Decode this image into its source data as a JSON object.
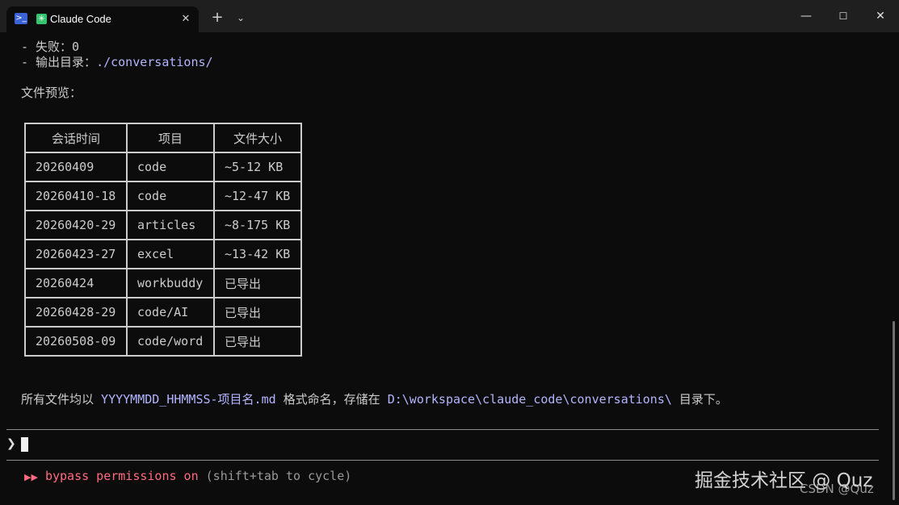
{
  "titlebar": {
    "tab_title": "Claude Code",
    "tab_icon": "powershell-icon",
    "tab_badge_icon": "claude-asterisk-icon",
    "close_icon": "close-icon",
    "new_tab_icon": "plus-icon",
    "dropdown_icon": "chevron-down-icon",
    "window_controls": [
      "minimize-icon",
      "maximize-icon",
      "close-icon"
    ]
  },
  "output": {
    "failed_line": "- 失败：0",
    "output_dir_label": "- 输出目录：",
    "output_dir_path": "./conversations/",
    "preview_heading": "文件预览："
  },
  "table": {
    "headers": [
      "会话时间",
      "项目",
      "文件大小"
    ],
    "rows": [
      [
        "20260409",
        "code",
        "~5-12 KB"
      ],
      [
        "20260410-18",
        "code",
        "~12-47 KB"
      ],
      [
        "20260420-29",
        "articles",
        "~8-175 KB"
      ],
      [
        "20260423-27",
        "excel",
        "~13-42 KB"
      ],
      [
        "20260424",
        "workbuddy",
        "已导出"
      ],
      [
        "20260428-29",
        "code/AI",
        "已导出"
      ],
      [
        "20260508-09",
        "code/word",
        "已导出"
      ]
    ]
  },
  "summary": {
    "prefix": "所有文件均以 ",
    "pattern": "YYYYMMDD_HHMMSS-项目名.md",
    "middle": " 格式命名，存储在 ",
    "path": "D:\\workspace\\claude_code\\conversations\\",
    "suffix": " 目录下。"
  },
  "prompt": {
    "arrow": "❯"
  },
  "status": {
    "icon": "▶▶",
    "mode_label": "bypass permissions on",
    "hint": " (shift+tab to cycle)"
  },
  "watermark": {
    "main": "掘金技术社区 @ Quz",
    "sub": "CSDN @Quz"
  },
  "colors": {
    "background": "#0c0c0c",
    "titlebar": "#1f1f1f",
    "text": "#cccccc",
    "path_accent": "#b4b4ff",
    "status_accent": "#ff6b80"
  }
}
